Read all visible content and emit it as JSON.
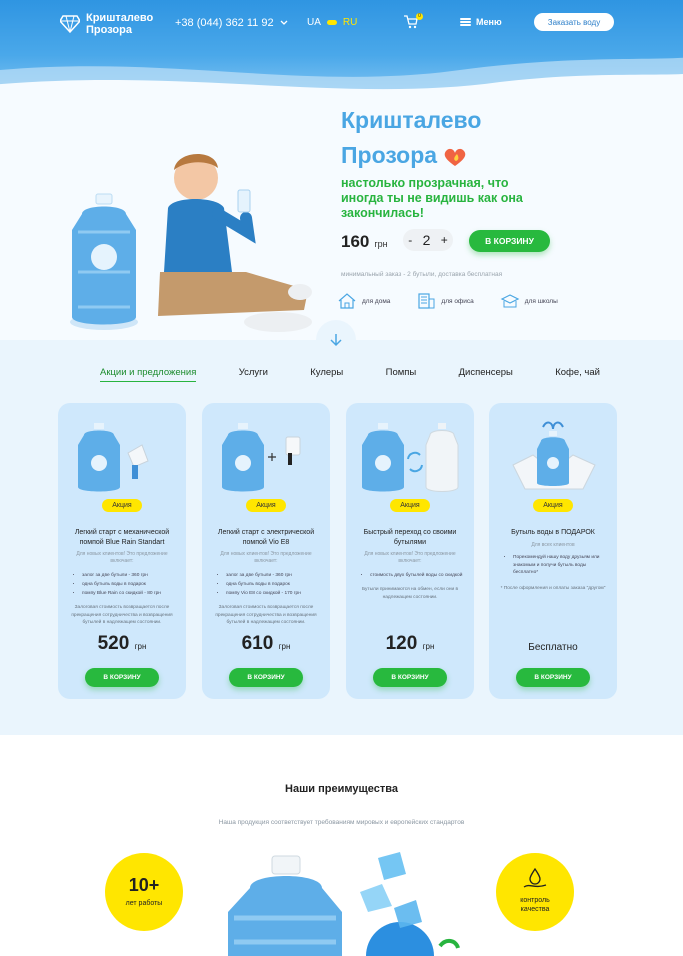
{
  "header": {
    "logo_line1": "Кришталево",
    "logo_line2": "Прозора",
    "phone": "+38 (044) 362 11 92",
    "lang_ua": "UA",
    "lang_ru": "RU",
    "cart_count": "0",
    "menu_label": "Меню",
    "order_button": "Заказать воду",
    "icons": [
      "diamond-logo-icon",
      "chevron-down-icon",
      "cart-icon",
      "menu-icon"
    ]
  },
  "hero": {
    "title_line1": "Кришталево",
    "title_line2": "Прозора",
    "tagline": "настолько прозрачная, что иногда ты не видишь как она закончилась!",
    "price": "160",
    "currency": "грн",
    "qty_minus": "-",
    "qty_value": "2",
    "qty_plus": "+",
    "cart_button": "В КОРЗИНУ",
    "min_order": "минимальный заказ - 2 бутыли, доставка бесплатная",
    "uses": [
      {
        "label": "для дома",
        "icon": "house-icon"
      },
      {
        "label": "для офиса",
        "icon": "office-icon"
      },
      {
        "label": "для школы",
        "icon": "school-icon"
      }
    ]
  },
  "tabs": [
    "Акции и предложения",
    "Услуги",
    "Кулеры",
    "Помпы",
    "Диспенсеры",
    "Кофе, чай"
  ],
  "cards": [
    {
      "badge": "Акция",
      "title": "Легкий старт с механической помпой Blue Rain Standart",
      "subtitle": "Для новых клиентов! Это предложение включает:",
      "items": [
        "залог за две бутыли - 360 грн",
        "одна бутыль воды в подарок",
        "помпу Blue Rain со скидкой - 80 грн"
      ],
      "note": "Залоговая стоимость возвращается после прекращения сотрудничества и возвращения бутылей в надлежащем состоянии.",
      "price": "520",
      "currency": "грн",
      "button": "В КОРЗИНУ"
    },
    {
      "badge": "Акция",
      "title": "Легкий старт с электрической помпой Vio E8",
      "subtitle": "Для новых клиентов! Это предложение включает:",
      "items": [
        "залог за две бутыли - 360 грн",
        "одна бутыль воды в подарок",
        "помпу Vio E8 со скидкой - 170 грн"
      ],
      "note": "Залоговая стоимость возвращается после прекращения сотрудничества и возвращения бутылей в надлежащем состоянии.",
      "price": "610",
      "currency": "грн",
      "button": "В КОРЗИНУ"
    },
    {
      "badge": "Акция",
      "title": "Быстрый переход со своими бутылями",
      "subtitle": "Для новых клиентов! Это предложение включает:",
      "items": [
        "стоимость двух бутылей воды со скидкой"
      ],
      "note": "Бутыли принимаются на обмен, если они в надлежащем состоянии.",
      "price": "120",
      "currency": "грн",
      "button": "В КОРЗИНУ"
    },
    {
      "badge": "Акция",
      "title": "Бутыль воды в ПОДАРОК",
      "subtitle": "Для всех клиентов",
      "items": [
        "Порекомендуй нашу воду друзьям или знакомым и получи бутыль воды бесплатно*"
      ],
      "note": "* После оформления и оплаты заказа \"другом\"",
      "free": "Бесплатно",
      "button": "В КОРЗИНУ"
    }
  ],
  "advantages": {
    "title": "Наши преимущества",
    "subtitle": "Наша продукция соответствует требованиям мировых и европейских стандартов",
    "years_value": "10+",
    "years_label": "лет работы",
    "quality_label_1": "контроль",
    "quality_label_2": "качества"
  },
  "colors": {
    "accent_blue": "#4aa6e3",
    "green": "#28b93e",
    "yellow": "#ffe600"
  }
}
